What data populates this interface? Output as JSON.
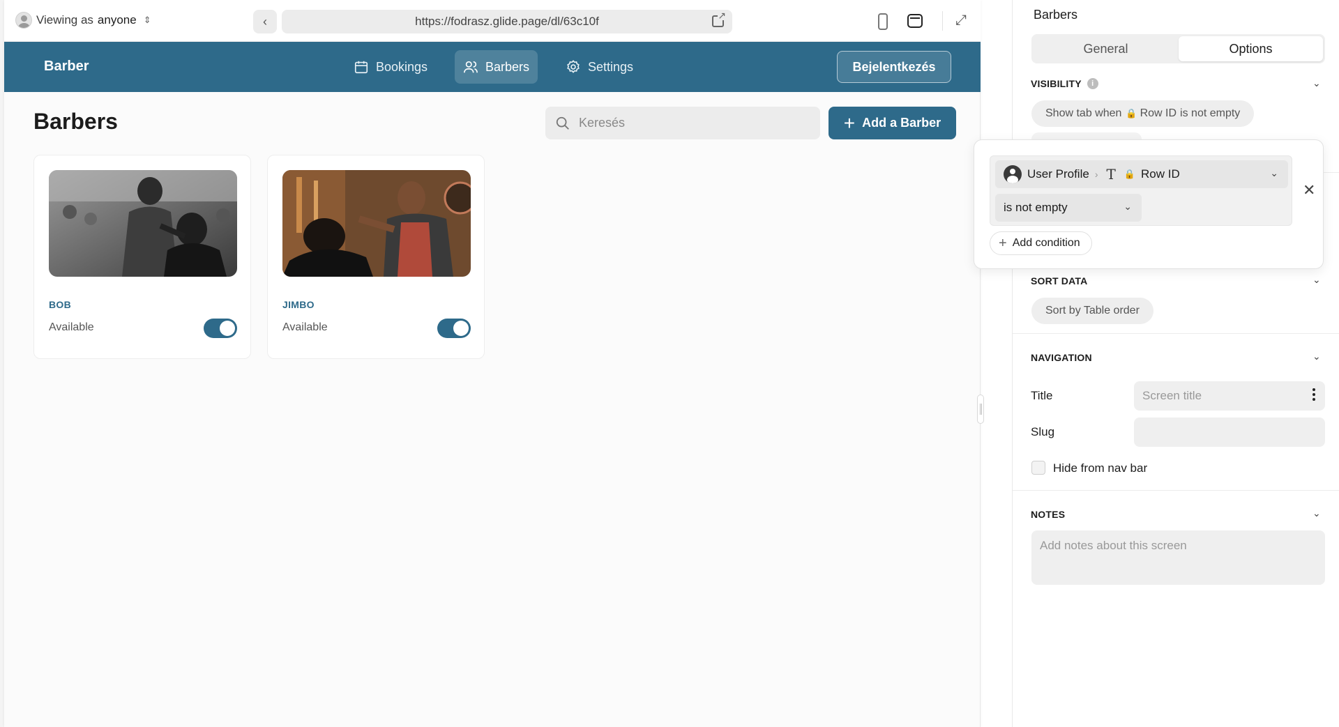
{
  "topbar": {
    "viewing_prefix": "Viewing as",
    "viewing_user": "anyone",
    "url": "https://fodrasz.glide.page/dl/63c10f"
  },
  "app": {
    "brand": "Barber",
    "nav": [
      {
        "label": "Bookings"
      },
      {
        "label": "Barbers"
      },
      {
        "label": "Settings"
      }
    ],
    "login_label": "Bejelentkezés"
  },
  "page": {
    "title": "Barbers",
    "search_placeholder": "Keresés",
    "add_label": "Add a Barber"
  },
  "barbers": [
    {
      "name": "BOB",
      "status": "Available",
      "available": true
    },
    {
      "name": "JIMBO",
      "status": "Available",
      "available": true
    }
  ],
  "config": {
    "title": "Barbers",
    "tabs": [
      {
        "label": "General"
      },
      {
        "label": "Options"
      }
    ],
    "visibility": {
      "label": "VISIBILITY",
      "chip_prefix": "Show tab when",
      "chip_field": "Row ID",
      "chip_suffix": "is not empty"
    },
    "condition": {
      "source": "User Profile",
      "field": "Row ID",
      "operator": "is not empty",
      "add_label": "Add condition"
    },
    "sort": {
      "label": "SORT DATA",
      "chip": "Sort by Table order"
    },
    "navigation": {
      "label": "NAVIGATION",
      "title_label": "Title",
      "title_placeholder": "Screen title",
      "slug_label": "Slug",
      "hide_label": "Hide from nav bar"
    },
    "notes": {
      "label": "NOTES",
      "placeholder": "Add notes about this screen"
    }
  },
  "colors": {
    "brand": "#2e6a8a"
  }
}
